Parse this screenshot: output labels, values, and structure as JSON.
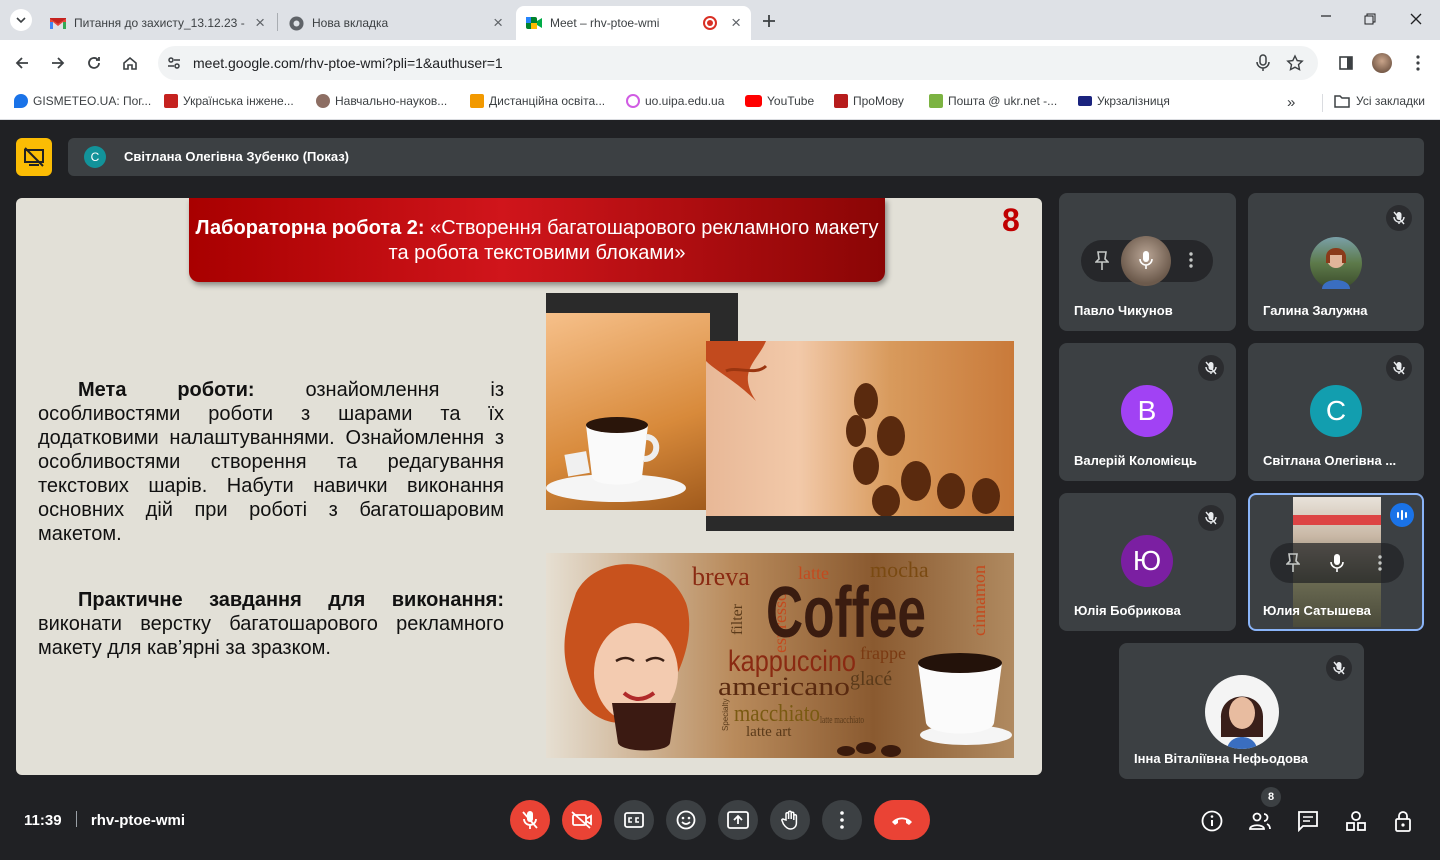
{
  "browser": {
    "tabs": [
      {
        "title": "Питання до захисту_13.12.23 -",
        "icon": "gmail-icon"
      },
      {
        "title": "Нова вкладка",
        "icon": "chrome-icon"
      },
      {
        "title": "Meet – rhv-ptoe-wmi",
        "icon": "meet-icon",
        "active": true
      }
    ],
    "url": "meet.google.com/rhv-ptoe-wmi?pli=1&authuser=1",
    "bookmarks": [
      {
        "label": "GISMETEO.UA: Пог...",
        "color": "#1a73e8"
      },
      {
        "label": "Українська інжене...",
        "color": "#c5221f"
      },
      {
        "label": "Навчально-науков...",
        "color": "#8d6e63"
      },
      {
        "label": "Дистанційна освіта...",
        "color": "#f29900"
      },
      {
        "label": "uo.uipa.edu.ua",
        "color": "#d05ce3"
      },
      {
        "label": "YouTube",
        "color": "#ff0000"
      },
      {
        "label": "ПроМову",
        "color": "#b71c1c"
      },
      {
        "label": "Пошта @ ukr.net -...",
        "color": "#7cb342"
      },
      {
        "label": "Укрзалізниця",
        "color": "#1a237e"
      }
    ],
    "all_bookmarks": "Усі закладки"
  },
  "meeting": {
    "presenter_initial": "С",
    "presenter_label": "Світлана Олегівна Зубенко (Показ)",
    "time": "11:39",
    "code": "rhv-ptoe-wmi",
    "participant_count": "8"
  },
  "slide": {
    "title_bold": "Лабораторна робота 2:",
    "title_rest": " «Створення багатошарового рекламного макету та робота текстовими блоками»",
    "number": "8",
    "goal_label": "Мета роботи:",
    "goal_text": " ознайомлення із особливостями роботи з шарами та їх додатковими налаштуваннями. Ознайомлення з особливостями створення та редагування текстових шарів. Набути навички виконання основних дій при роботі з багатошаровим макетом.",
    "task_label": "Практичне завдання для виконання:",
    "task_text": " виконати верстку багатошарового рекламного макету для кав’ярні за зразком.",
    "coffee_words": [
      "breva",
      "latte",
      "mocha",
      "filter",
      "espresso",
      "Coffee",
      "cinnamon",
      "kappuccino",
      "frappe",
      "americano",
      "glacé",
      "macchiato",
      "latte art",
      "latte macchiato",
      "Specialty"
    ]
  },
  "participants": [
    {
      "name": "Павло Чикунов",
      "kind": "photo",
      "hover": true
    },
    {
      "name": "Галина Залужна",
      "kind": "photo",
      "muted": true
    },
    {
      "name": "Валерій Коломієць",
      "initial": "В",
      "color": "#a142f4",
      "muted": true
    },
    {
      "name": "Світлана Олегівна ...",
      "initial": "С",
      "color": "#129eaf",
      "muted": true
    },
    {
      "name": "Юлія Бобрикова",
      "initial": "Ю",
      "color": "#7b1fa2",
      "muted": true
    },
    {
      "name": "Юлия Сатышева",
      "kind": "video",
      "speaking": true,
      "hover": true
    },
    {
      "name": "Інна Віталіївна Нефьодова",
      "kind": "photo",
      "muted": true
    }
  ]
}
